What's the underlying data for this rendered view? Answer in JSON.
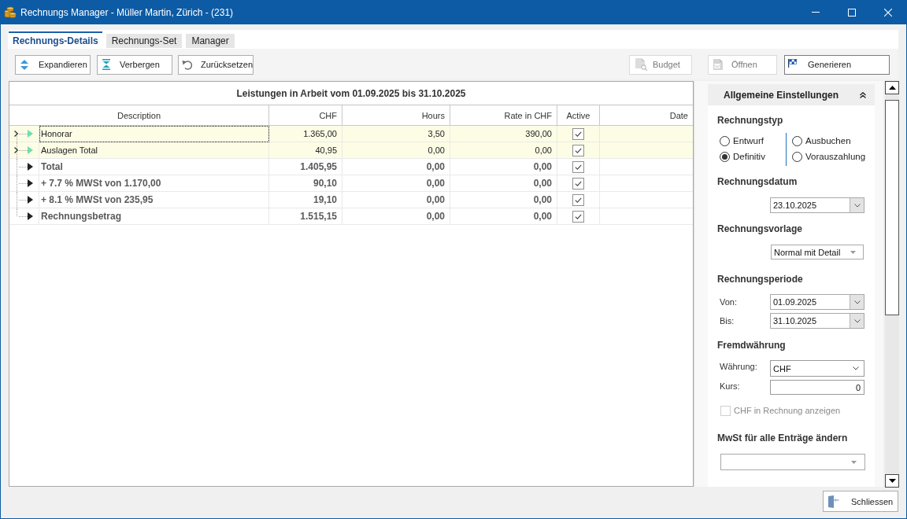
{
  "window": {
    "title": "Rechnungs Manager - Müller Martin, Zürich - (231)"
  },
  "tabs": [
    {
      "label": "Rechnungs-Details",
      "selected": true
    },
    {
      "label": "Rechnungs-Set",
      "selected": false
    },
    {
      "label": "Manager",
      "selected": false
    }
  ],
  "toolbar": {
    "left_buttons": [
      {
        "label": "Expandieren"
      },
      {
        "label": "Verbergen"
      },
      {
        "label": "Zurücksetzen"
      }
    ],
    "right_buttons": [
      {
        "label": "Budget",
        "disabled": true
      },
      {
        "label": "Öffnen",
        "disabled": true
      },
      {
        "label": "Generieren",
        "disabled": false
      }
    ]
  },
  "table": {
    "title": "Leistungen in Arbeit vom 01.09.2025 bis 31.10.2025",
    "columns": [
      "Description",
      "CHF",
      "Hours",
      "Rate in CHF",
      "Active",
      "Date"
    ],
    "rows": [
      {
        "kind": "entry",
        "description": "Honorar",
        "chf": "1.365,00",
        "hours": "3,50",
        "rate": "390,00",
        "active": true,
        "focused": true
      },
      {
        "kind": "entry",
        "description": "Auslagen Total",
        "chf": "40,95",
        "hours": "0,00",
        "rate": "0,00",
        "active": true,
        "focused": false
      },
      {
        "kind": "summary",
        "description": "Total",
        "chf": "1.405,95",
        "hours": "0,00",
        "rate": "0,00",
        "active": true,
        "focused": false
      },
      {
        "kind": "summary",
        "description": "+ 7.7 % MWSt von 1.170,00",
        "chf": "90,10",
        "hours": "0,00",
        "rate": "0,00",
        "active": true,
        "focused": false
      },
      {
        "kind": "summary",
        "description": "+ 8.1 % MWSt von 235,95",
        "chf": "19,10",
        "hours": "0,00",
        "rate": "0,00",
        "active": true,
        "focused": false
      },
      {
        "kind": "summary",
        "description": "Rechnungsbetrag",
        "chf": "1.515,15",
        "hours": "0,00",
        "rate": "0,00",
        "active": true,
        "focused": false
      }
    ]
  },
  "settings": {
    "title": "Allgemeine Einstellungen",
    "invoice_type": {
      "heading": "Rechnungstyp",
      "option_columns": [
        [
          {
            "label": "Entwurf",
            "selected": false
          },
          {
            "label": "Definitiv",
            "selected": true
          }
        ],
        [
          {
            "label": "Ausbuchen",
            "selected": false
          },
          {
            "label": "Vorauszahlung",
            "selected": false
          }
        ]
      ]
    },
    "invoice_date": {
      "heading": "Rechnungsdatum",
      "value": "23.10.2025"
    },
    "template": {
      "heading": "Rechnungsvorlage",
      "value": "Normal mit Detail"
    },
    "period": {
      "heading": "Rechnungsperiode",
      "fields": [
        {
          "label": "Von:",
          "value": "01.09.2025"
        },
        {
          "label": "Bis:",
          "value": "31.10.2025"
        }
      ]
    },
    "currency": {
      "heading": "Fremdwährung",
      "fields": [
        {
          "kind": "select",
          "label": "Währung:",
          "value": "CHF"
        },
        {
          "kind": "number",
          "label": "Kurs:",
          "value": "0"
        }
      ],
      "show_chf": {
        "label": "CHF in Rechnung anzeigen",
        "checked": false,
        "disabled": true
      }
    },
    "vat": {
      "heading": "MwSt für alle Enträge ändern"
    }
  },
  "footer": {
    "close_button": "Schliessen"
  }
}
